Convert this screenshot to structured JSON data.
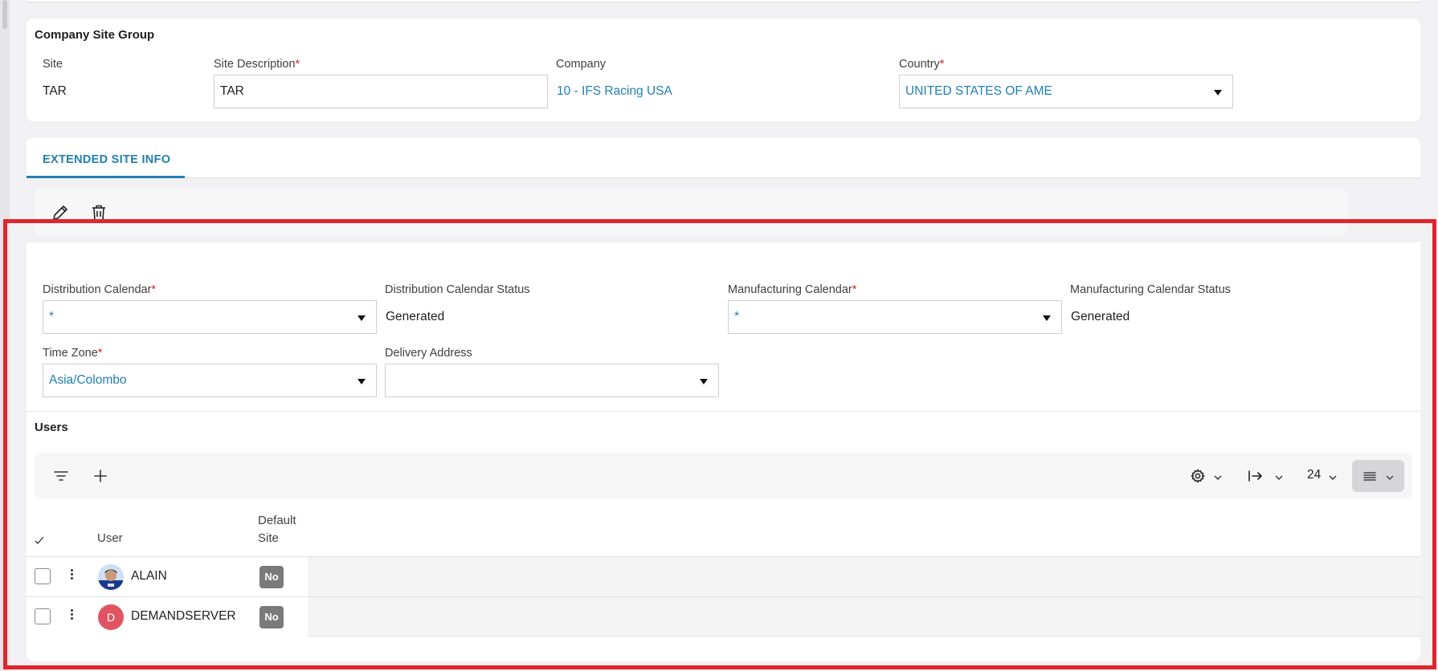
{
  "company_site_group": {
    "title": "Company Site Group",
    "site_label": "Site",
    "site_value": "TAR",
    "site_description_label": "Site Description",
    "site_description_value": "TAR",
    "company_label": "Company",
    "company_value": "10 - IFS Racing USA",
    "country_label": "Country",
    "country_value": "UNITED STATES OF AME",
    "required_mark": "*"
  },
  "tabs": [
    {
      "label": "EXTENDED SITE INFO",
      "active": true
    }
  ],
  "top_toolbar": {
    "icons": [
      "edit-icon",
      "trash-icon"
    ]
  },
  "extended": {
    "distribution_calendar_label": "Distribution Calendar",
    "distribution_calendar_value": "*",
    "distribution_calendar_status_label": "Distribution Calendar Status",
    "distribution_calendar_status_value": "Generated",
    "manufacturing_calendar_label": "Manufacturing Calendar",
    "manufacturing_calendar_value": "*",
    "manufacturing_calendar_status_label": "Manufacturing Calendar Status",
    "manufacturing_calendar_status_value": "Generated",
    "time_zone_label": "Time Zone",
    "time_zone_value": "Asia/Colombo",
    "delivery_address_label": "Delivery Address",
    "delivery_address_value": ""
  },
  "users": {
    "title": "Users",
    "page_size": "24",
    "columns": {
      "user": "User",
      "default_site_line1": "Default",
      "default_site_line2": "Site"
    },
    "rows": [
      {
        "user": "ALAIN",
        "default_site": "No",
        "avatar": "photo"
      },
      {
        "user": "DEMANDSERVER",
        "default_site": "No",
        "avatar": "D"
      }
    ]
  },
  "colors": {
    "accent": "#1f7fb3",
    "required": "#d8202c",
    "highlight": "#e1252c",
    "avatar_d": "#e05461"
  }
}
